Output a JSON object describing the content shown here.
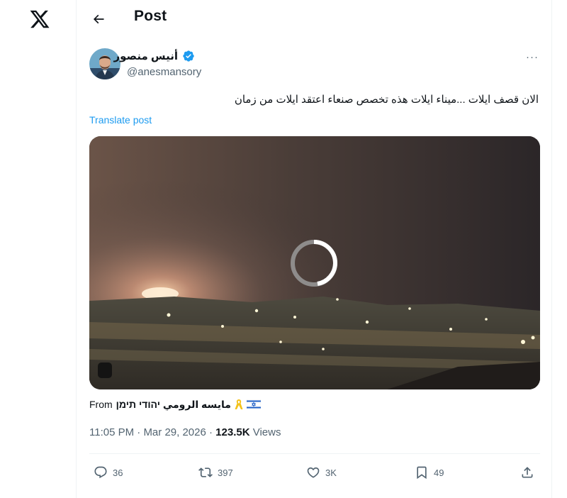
{
  "app": {
    "logo_icon": "x-logo-icon"
  },
  "header": {
    "back_icon": "arrow-left-icon",
    "title": "Post"
  },
  "author": {
    "display_name": "أنيس منصور",
    "handle": "@anesmansory",
    "verified_icon": "verified-badge-icon",
    "avatar_icon": "avatar-photo"
  },
  "post": {
    "text": "الان قصف ايلات ...ميناء ايلات هذه تخصص صنعاء اعتقد ايلات من زمان",
    "translate_label": "Translate post",
    "more_icon": "more-horizontal-icon",
    "more_label": "···"
  },
  "media": {
    "kind": "video",
    "state_icon": "loading-spinner-icon"
  },
  "source": {
    "from_label": "From",
    "name": "مايسه الرومي יהודי תימן",
    "flag_icon": "israel-flag-icon",
    "ribbon_icon": "yellow-ribbon-icon"
  },
  "meta": {
    "time": "11:05 PM",
    "separator": "·",
    "date": "Mar 29, 2026",
    "views_count": "123.5K",
    "views_label": "Views"
  },
  "actions": {
    "reply": {
      "icon": "reply-icon",
      "count": "36"
    },
    "repost": {
      "icon": "repost-icon",
      "count": "397"
    },
    "like": {
      "icon": "heart-icon",
      "count": "3K"
    },
    "bookmark": {
      "icon": "bookmark-icon",
      "count": "49"
    },
    "share": {
      "icon": "share-icon"
    }
  },
  "colors": {
    "text_primary": "#0f1419",
    "text_secondary": "#536471",
    "link": "#1d9bf0",
    "verified": "#1d9bf0",
    "border": "#eff3f4"
  }
}
